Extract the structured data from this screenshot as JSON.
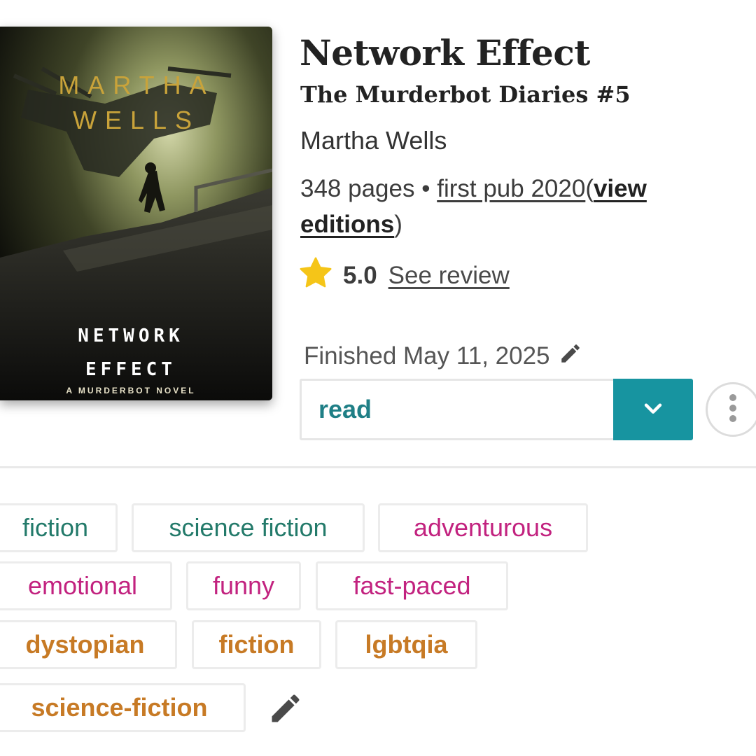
{
  "book": {
    "title": "Network Effect",
    "series": "The Murderbot Diaries #5",
    "author": "Martha Wells",
    "pages": "348 pages",
    "separator": "•",
    "first_pub": "first pub 2020",
    "paren_open": "(",
    "view_editions_1": "view",
    "view_editions_2": "editions",
    "paren_close": ")"
  },
  "cover": {
    "author_line1": "MARTHA",
    "author_line2": "WELLS",
    "title_line1": "NETWORK",
    "title_line2": "EFFECT",
    "tagline": "A MURDERBOT NOVEL"
  },
  "rating": {
    "icon": "star-icon",
    "value": "5.0",
    "link": "See review",
    "star_color": "#f5c518"
  },
  "status": {
    "finished": "Finished May 11, 2025",
    "edit_icon": "pencil-icon"
  },
  "shelf": {
    "value": "read",
    "dropdown_icon": "chevron-down-icon",
    "more_icon": "vertical-dots-icon",
    "accent": "#1794a0"
  },
  "tags": {
    "genres": [
      "fiction",
      "science fiction"
    ],
    "moods": [
      "adventurous",
      "emotional",
      "funny",
      "fast-paced"
    ],
    "user_tags": [
      "dystopian",
      "fiction",
      "lgbtqia",
      "science-fiction"
    ],
    "edit_icon": "pencil-icon"
  }
}
